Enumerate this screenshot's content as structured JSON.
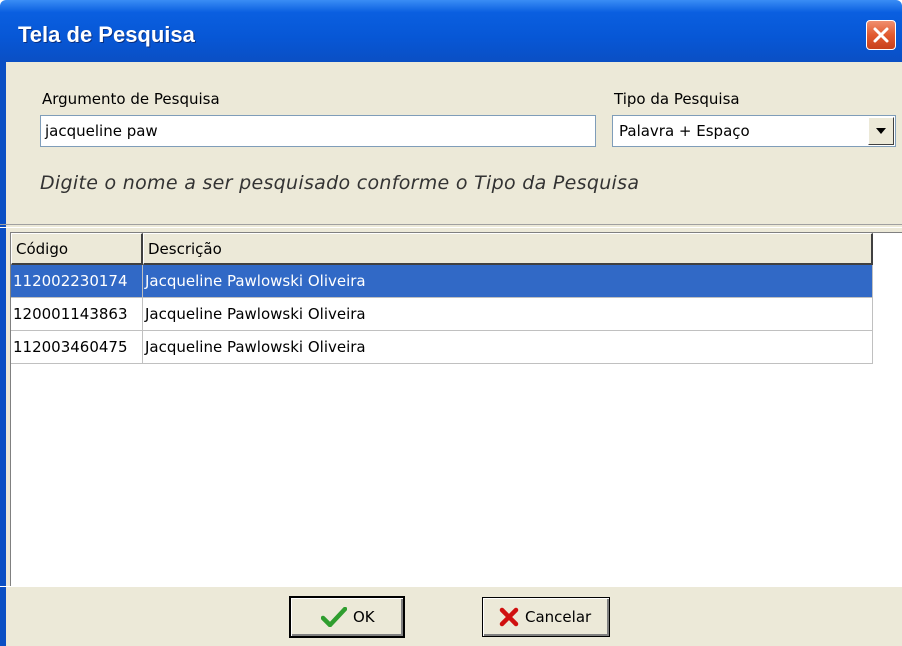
{
  "window": {
    "title": "Tela de Pesquisa"
  },
  "search": {
    "argument_label": "Argumento de Pesquisa",
    "argument_value": "jacqueline paw",
    "type_label": "Tipo da Pesquisa",
    "type_value": "Palavra + Espaço",
    "hint": "Digite o nome a ser pesquisado conforme o Tipo da Pesquisa"
  },
  "grid": {
    "columns": [
      "Código",
      "Descrição"
    ],
    "rows": [
      {
        "codigo": "112002230174",
        "descricao": "Jacqueline Pawlowski Oliveira",
        "selected": true
      },
      {
        "codigo": "120001143863",
        "descricao": "Jacqueline Pawlowski Oliveira",
        "selected": false
      },
      {
        "codigo": "112003460475",
        "descricao": "Jacqueline Pawlowski Oliveira",
        "selected": false
      }
    ]
  },
  "buttons": {
    "ok_label": "OK",
    "cancel_label": "Cancelar"
  },
  "icons": {
    "close": "close-icon",
    "dropdown": "chevron-down-icon",
    "ok": "checkmark-icon",
    "cancel": "x-icon"
  },
  "colors": {
    "titlebar": "#0757d6",
    "selection": "#3169c6",
    "panel": "#ece9d8",
    "ok_check": "#2f9e2f",
    "cancel_x": "#d01010"
  }
}
